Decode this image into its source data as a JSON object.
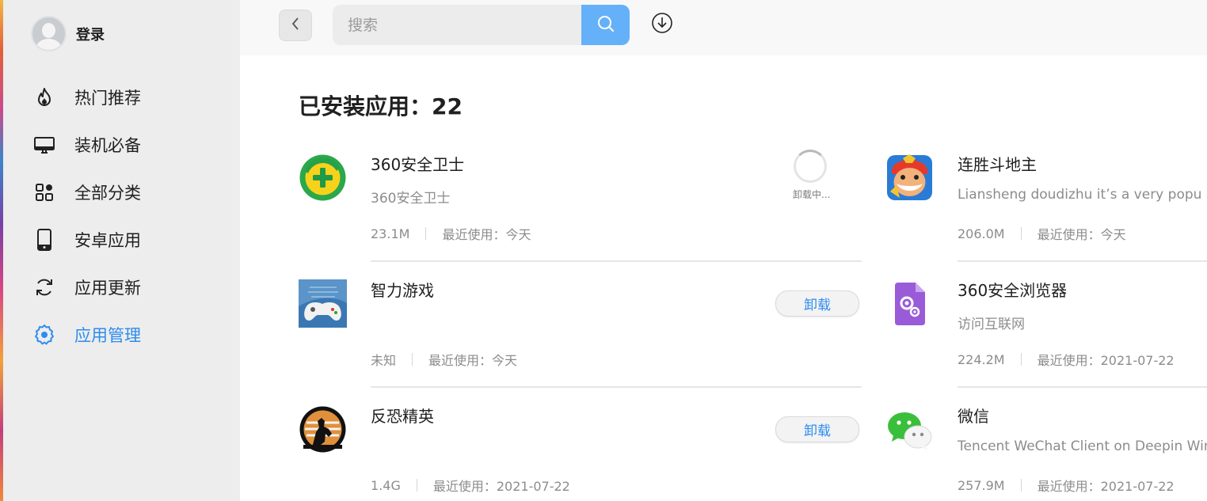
{
  "sidebar": {
    "login_label": "登录",
    "items": [
      {
        "label": "热门推荐",
        "icon": "flame-icon"
      },
      {
        "label": "装机必备",
        "icon": "monitor-icon"
      },
      {
        "label": "全部分类",
        "icon": "grid-icon"
      },
      {
        "label": "安卓应用",
        "icon": "phone-icon"
      },
      {
        "label": "应用更新",
        "icon": "refresh-icon"
      },
      {
        "label": "应用管理",
        "icon": "gear-icon",
        "active": true
      }
    ],
    "active_color": "#2d8cf0"
  },
  "header": {
    "search_placeholder": "搜索",
    "search_button_color": "#64b1f9"
  },
  "main": {
    "title": "已安装应用：22",
    "uninstalling_label": "卸载中...",
    "uninstall_label": "卸载",
    "apps_left": [
      {
        "name": "360安全卫士",
        "desc": "360安全卫士",
        "size": "23.1M",
        "last_used": "最近使用：今天",
        "status": "uninstalling"
      },
      {
        "name": "智力游戏",
        "desc": "",
        "size": "未知",
        "last_used": "最近使用：今天",
        "status": "installed"
      },
      {
        "name": "反恐精英",
        "desc": "",
        "size": "1.4G",
        "last_used": "最近使用：2021-07-22",
        "status": "installed"
      }
    ],
    "apps_right": [
      {
        "name": "连胜斗地主",
        "desc": "Liansheng doudizhu it’s a very popu",
        "size": "206.0M",
        "last_used": "最近使用：今天"
      },
      {
        "name": "360安全浏览器",
        "desc": "访问互联网",
        "size": "224.2M",
        "last_used": "最近使用：2021-07-22"
      },
      {
        "name": "微信",
        "desc": "Tencent WeChat Client on Deepin Win",
        "size": "257.9M",
        "last_used": "最近使用：2021-07-22"
      }
    ]
  }
}
